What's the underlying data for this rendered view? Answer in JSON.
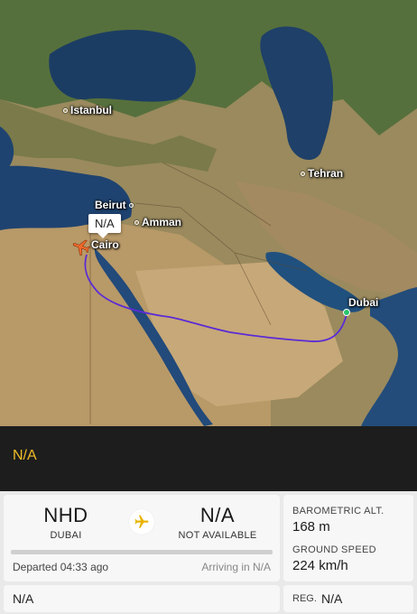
{
  "map": {
    "cities": [
      {
        "id": "istanbul",
        "name": "Istanbul"
      },
      {
        "id": "tehran",
        "name": "Tehran"
      },
      {
        "id": "beirut",
        "name": "Beirut"
      },
      {
        "id": "amman",
        "name": "Amman"
      },
      {
        "id": "cairo",
        "name": "Cairo"
      },
      {
        "id": "dubai",
        "name": "Dubai"
      }
    ],
    "callsign_tag": "N/A",
    "route_color": "#5a2bd6",
    "plane_color": "#f06a2b"
  },
  "status_bar": {
    "flight_id": "N/A",
    "accent": "#f2bd27"
  },
  "route": {
    "origin": {
      "code": "NHD",
      "name": "DUBAI"
    },
    "destination": {
      "code": "N/A",
      "name": "NOT AVAILABLE"
    },
    "departed": "Departed 04:33 ago",
    "arriving": "Arriving in N/A"
  },
  "stats": {
    "baro_alt_label": "BAROMETRIC ALT.",
    "baro_alt_value": "168 m",
    "ground_speed_label": "GROUND SPEED",
    "ground_speed_value": "224 km/h"
  },
  "aircraft": {
    "type": "N/A"
  },
  "registration": {
    "label": "REG.",
    "value": "N/A"
  }
}
